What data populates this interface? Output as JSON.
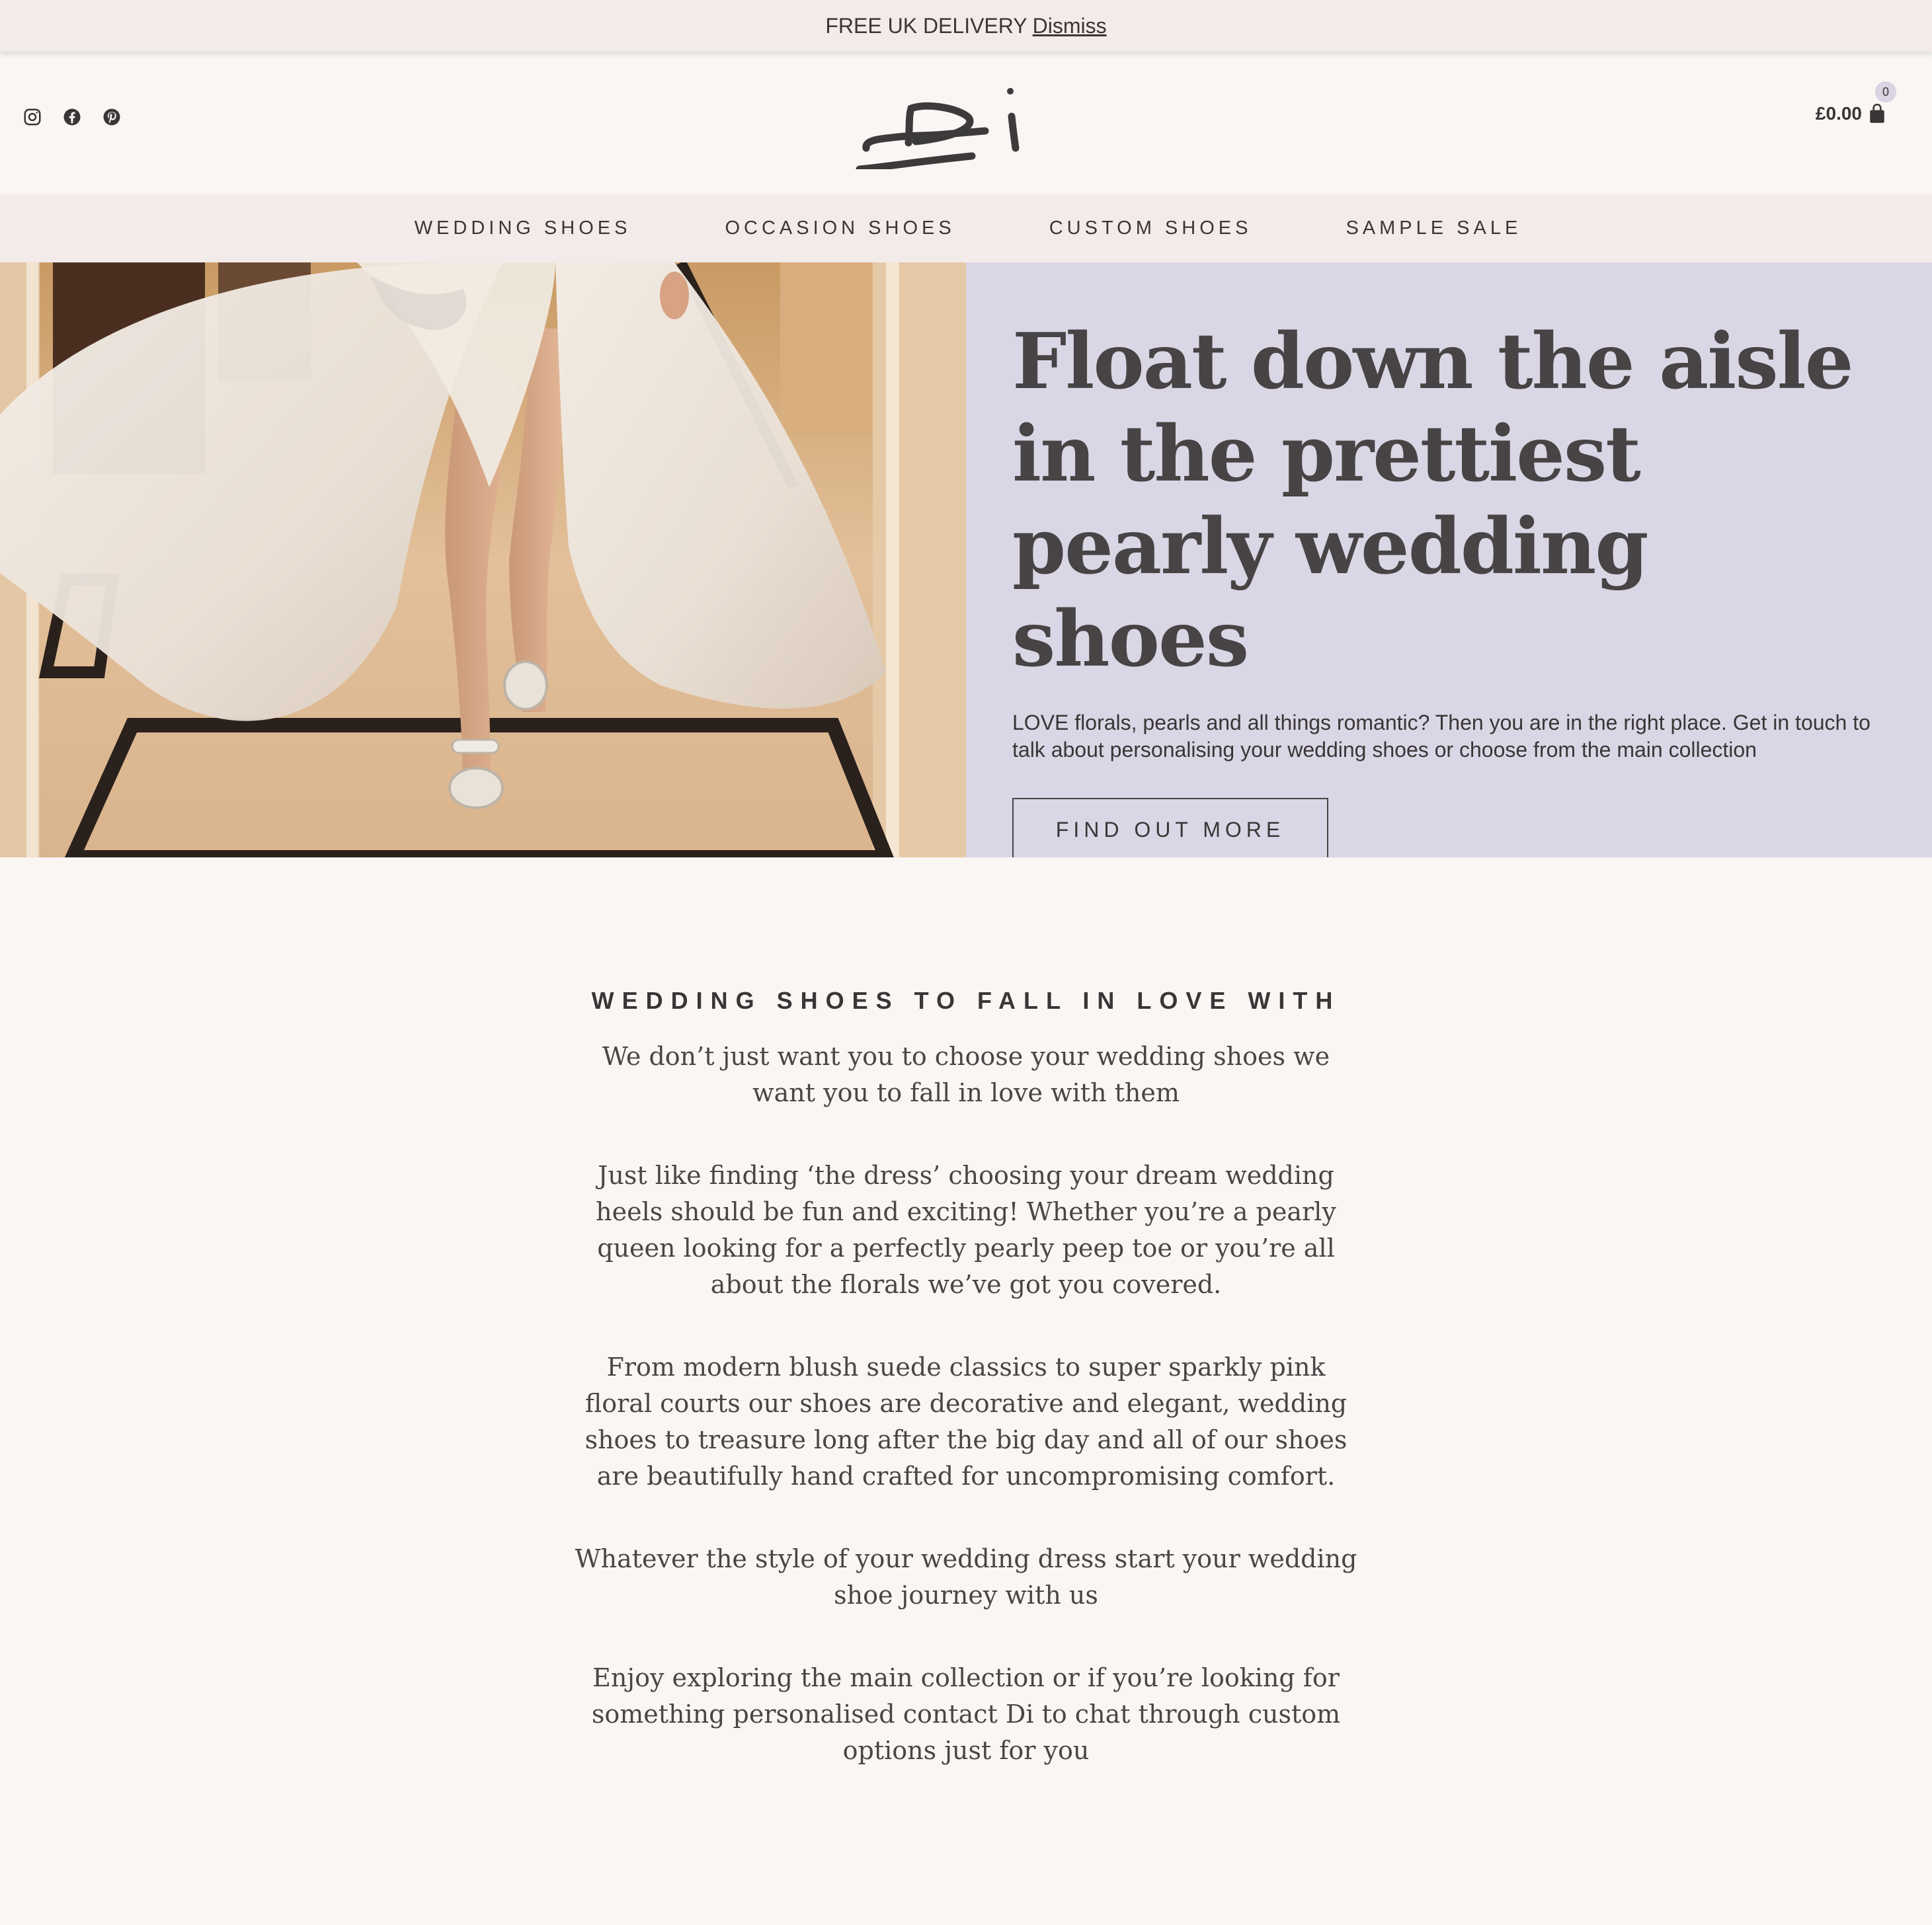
{
  "announcement": {
    "text": "FREE UK DELIVERY",
    "dismiss_label": "Dismiss"
  },
  "header": {
    "logo_text": "Di",
    "social_icons": [
      "instagram-icon",
      "facebook-icon",
      "pinterest-icon"
    ],
    "cart_total": "£0.00",
    "cart_count": "0"
  },
  "nav": {
    "items": [
      "WEDDING SHOES",
      "OCCASION SHOES",
      "CUSTOM SHOES",
      "SAMPLE SALE"
    ]
  },
  "hero": {
    "title": "Float down the aisle in the prettiest pearly wedding shoes",
    "description": "LOVE florals, pearls and all things romantic? Then you are in the right place. Get in touch to talk about personalising your wedding shoes or choose from the main collection",
    "button_label": "FIND OUT MORE"
  },
  "intro": {
    "heading": "WEDDING SHOES TO FALL IN LOVE WITH",
    "paragraphs": [
      "We don’t just want you to choose your wedding shoes we want you to fall in love with them",
      "Just like finding ‘the dress’ choosing your dream wedding heels should be fun and exciting! Whether you’re a pearly queen looking for a perfectly pearly peep toe or you’re all about the florals we’ve got you covered.",
      "From modern blush suede classics to super sparkly pink floral courts our shoes are decorative and elegant, wedding shoes to treasure long after the big day and all of our shoes are beautifully hand crafted for uncompromising comfort.",
      "Whatever the style of your wedding dress start your wedding shoe journey with us",
      "Enjoy exploring the main collection or if you’re looking for something personalised contact Di to chat through custom options just for you"
    ]
  },
  "colors": {
    "top_bar_bg": "#f3eaea",
    "page_bg": "#f9f6f3",
    "hero_panel_bg": "#d9d7e5",
    "text": "#484344"
  }
}
